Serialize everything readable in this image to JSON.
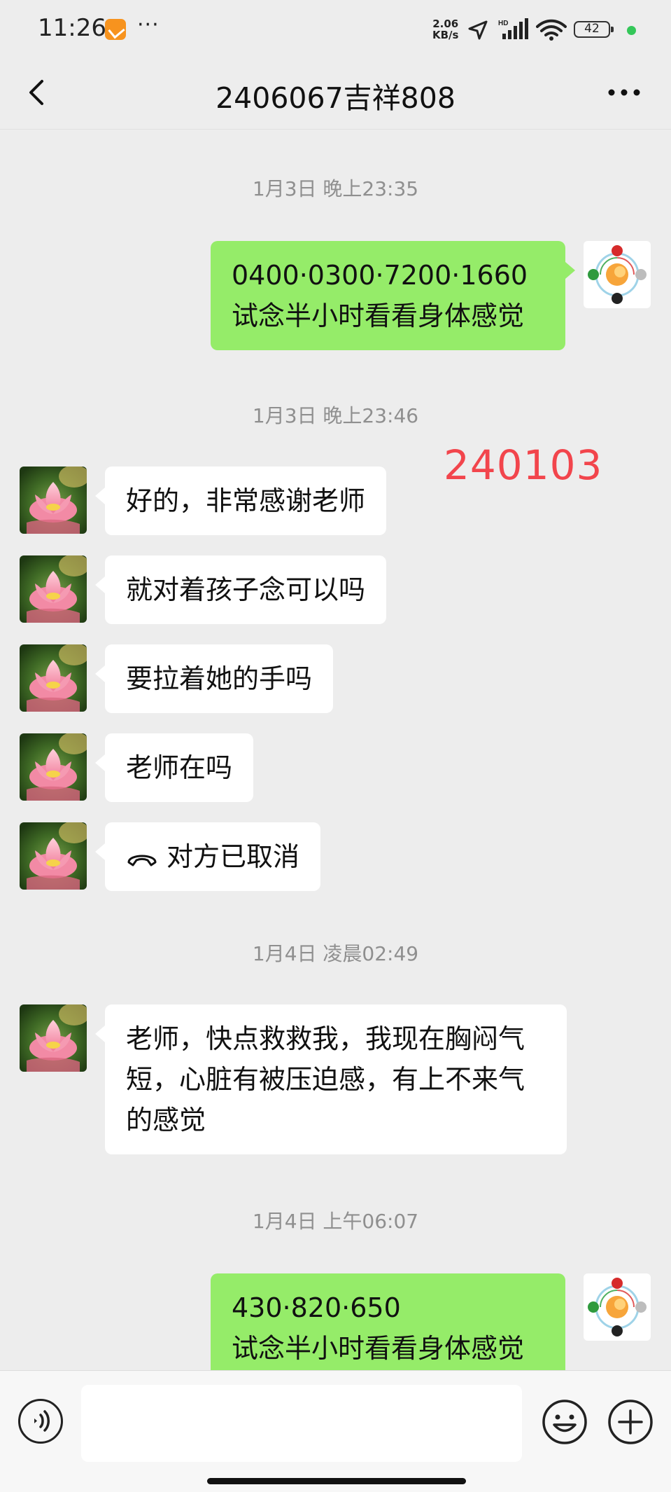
{
  "status_bar": {
    "time": "11:26",
    "more": "···",
    "net_speed_value": "2.06",
    "net_speed_unit": "KB/s",
    "battery": "42",
    "icons": [
      "app-notification-icon",
      "location-arrow-icon",
      "hd-signal-icon",
      "wifi-icon",
      "battery-icon"
    ]
  },
  "header": {
    "title": "2406067吉祥808",
    "back_icon": "chevron-left-icon",
    "more_icon": "ellipsis-icon"
  },
  "messages": [
    {
      "type": "time",
      "text": "1月3日 晚上23:35"
    },
    {
      "type": "out",
      "lines": [
        "0400·0300·7200·1660",
        "试念半小时看看身体感觉"
      ]
    },
    {
      "type": "time",
      "text": "1月3日 晚上23:46"
    },
    {
      "type": "in",
      "text": "好的，非常感谢老师"
    },
    {
      "type": "in",
      "text": "就对着孩子念可以吗"
    },
    {
      "type": "in",
      "text": "要拉着她的手吗"
    },
    {
      "type": "in",
      "text": "老师在吗"
    },
    {
      "type": "in-call",
      "text": "对方已取消",
      "icon": "phone-hangup-icon"
    },
    {
      "type": "time",
      "text": "1月4日 凌晨02:49"
    },
    {
      "type": "in",
      "lines": [
        "老师，快点救救我，我现在胸闷气",
        "短，心脏有被压迫感，有上不来气",
        "的感觉"
      ]
    },
    {
      "type": "time",
      "text": "1月4日 上午06:07"
    },
    {
      "type": "out",
      "lines": [
        "430·820·650",
        "试念半小时看看身体感觉"
      ]
    }
  ],
  "overlay_stamp": "240103",
  "input_bar": {
    "voice_icon": "voice-icon",
    "text_value": "",
    "emoji_icon": "emoji-icon",
    "plus_icon": "plus-circle-icon"
  },
  "colors": {
    "background": "#ededed",
    "outgoing_bubble": "#95ec69",
    "incoming_bubble": "#ffffff",
    "stamp": "#f2454c"
  }
}
